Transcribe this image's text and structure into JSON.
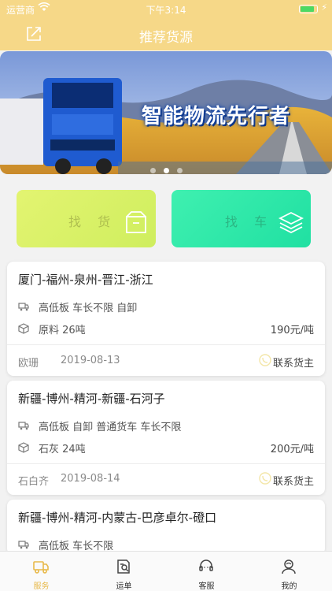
{
  "status_bar": {
    "carrier": "运营商",
    "time": "下午3:14",
    "battery_level": 0.85
  },
  "header": {
    "title": "推荐货源"
  },
  "banner": {
    "slogan": "智能物流先行者",
    "page_count": 3,
    "active_page": 1
  },
  "quick_actions": {
    "find_cargo": "找 货",
    "find_car": "找 车"
  },
  "cards": [
    {
      "route": "厦门-福州-泉州-晋江-浙江",
      "vehicle": "高低板 车长不限 自卸",
      "cargo": "原料  26吨",
      "price": "190元/吨",
      "name": "欧珊",
      "date": "2019-08-13",
      "contact": "联系货主"
    },
    {
      "route": "新疆-博州-精河-新疆-石河子",
      "vehicle": "高低板 自卸 普通货车 车长不限",
      "cargo": "石灰  24吨",
      "price": "200元/吨",
      "name": "石白齐",
      "date": "2019-08-14",
      "contact": "联系货主"
    },
    {
      "route": "新疆-博州-精河-内蒙古-巴彦卓尔-磴口",
      "vehicle": "高低板 车长不限"
    }
  ],
  "tabs": [
    {
      "label": "服务",
      "icon": "truck-icon",
      "active": true
    },
    {
      "label": "运单",
      "icon": "waybill-icon",
      "active": false
    },
    {
      "label": "客服",
      "icon": "headset-icon",
      "active": false
    },
    {
      "label": "我的",
      "icon": "profile-icon",
      "active": false
    }
  ],
  "colors": {
    "header": "#f6d888",
    "accent": "#e8b94a",
    "find_cargo_bg": "#d9f266",
    "find_car_bg": "#2ee8a8"
  }
}
